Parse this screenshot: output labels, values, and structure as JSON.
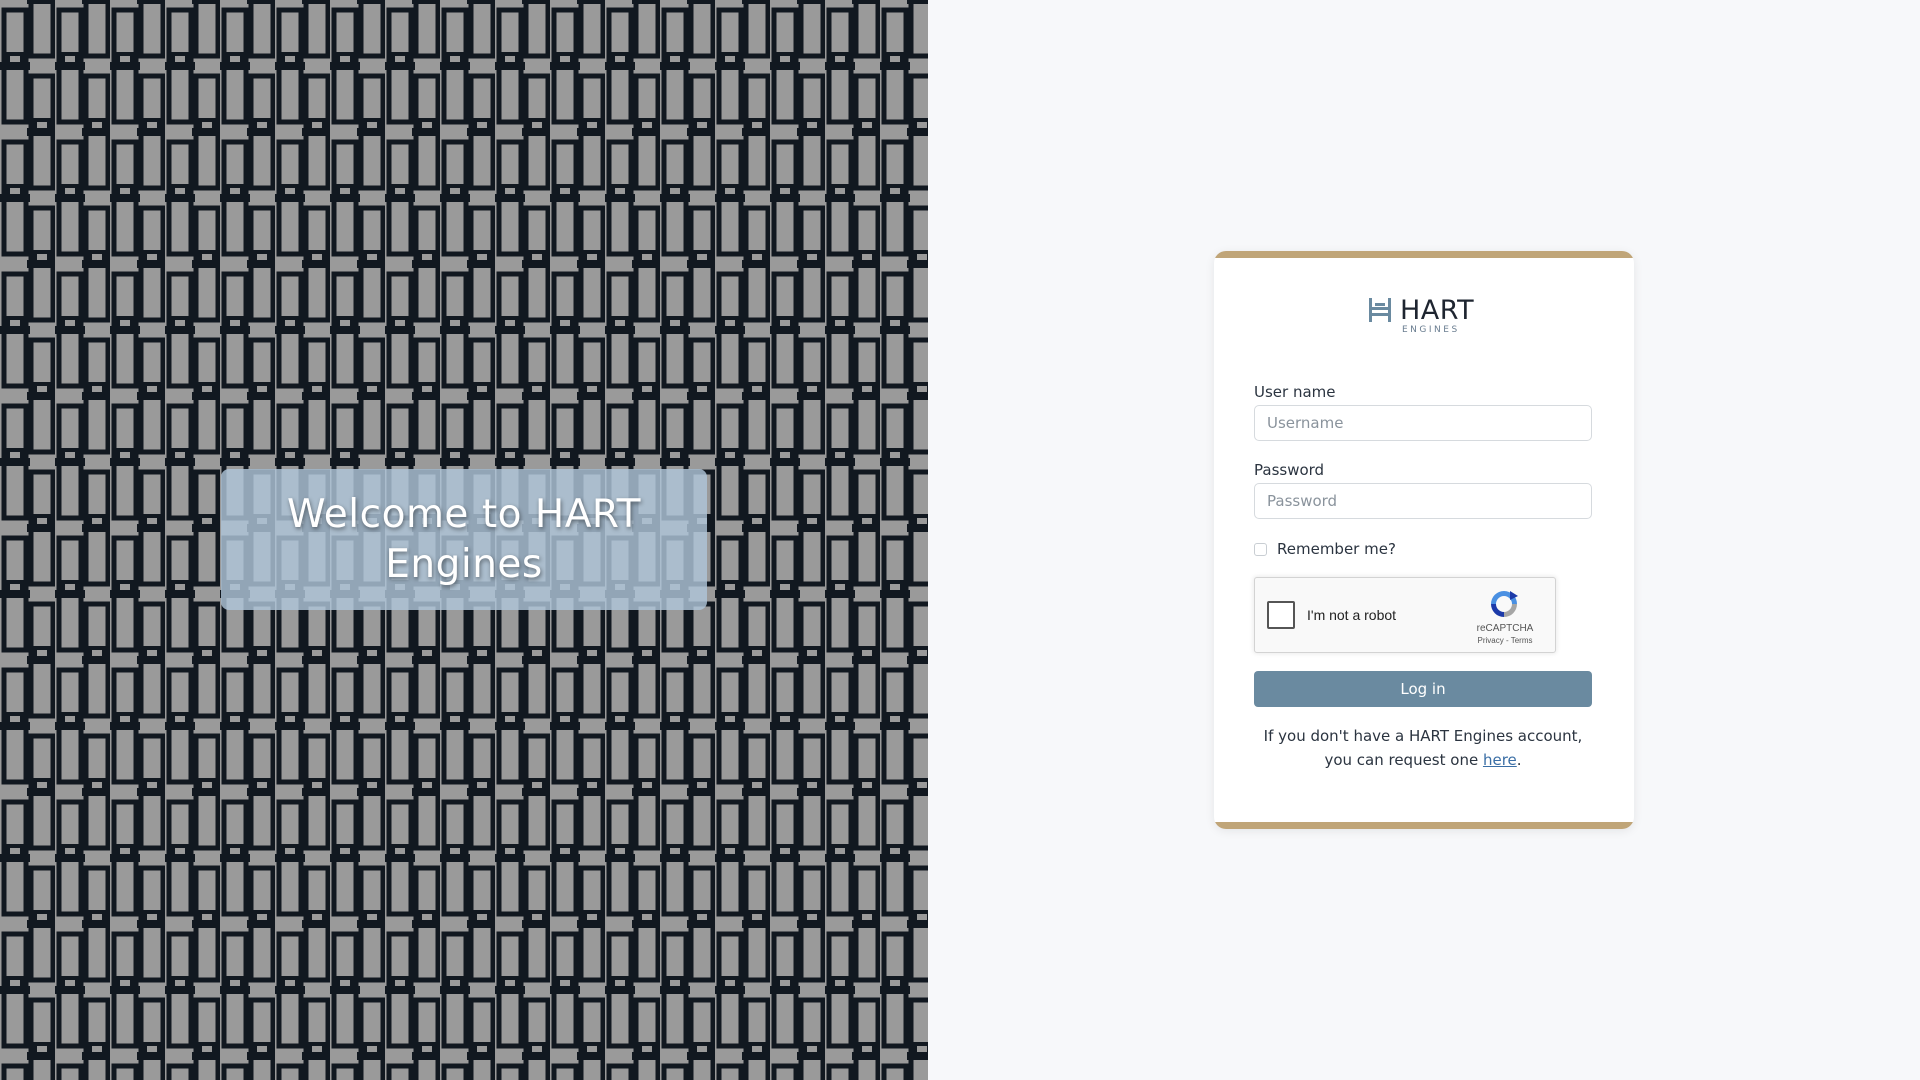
{
  "welcome": {
    "title": "Welcome to HART Engines"
  },
  "logo": {
    "wordmark": "HART",
    "subtitle": "ENGINES",
    "icon": "bed-icon"
  },
  "form": {
    "username_label": "User name",
    "username_placeholder": "Username",
    "username_value": "",
    "password_label": "Password",
    "password_placeholder": "Password",
    "password_value": "",
    "remember_label": "Remember me?",
    "remember_checked": false,
    "login_label": "Log in"
  },
  "recaptcha": {
    "label": "I'm not a robot",
    "brand": "reCAPTCHA",
    "privacy": "Privacy",
    "separator": " - ",
    "terms": "Terms"
  },
  "request": {
    "text_before": "If you don't have a HART Engines account, you can request one ",
    "link_text": "here",
    "text_after": "."
  },
  "colors": {
    "accent_gold": "#c0a578",
    "button": "#6a8aa0",
    "link": "#3a6ea5",
    "page_bg": "#f7f8fa"
  }
}
